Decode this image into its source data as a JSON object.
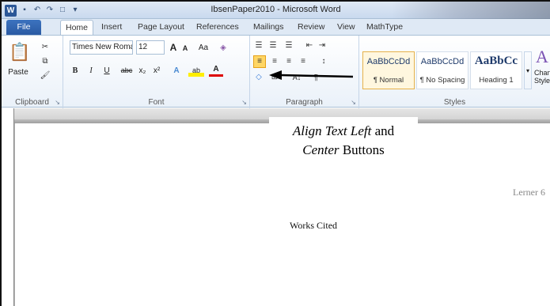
{
  "window": {
    "title": "IbsenPaper2010 - Microsoft Word",
    "app_logo": "W"
  },
  "tabs": [
    "File",
    "Home",
    "Insert",
    "Page Layout",
    "References",
    "Mailings",
    "Review",
    "View",
    "MathType"
  ],
  "clipboard": {
    "paste_label": "Paste",
    "group_label": "Clipboard"
  },
  "font": {
    "name": "Times New Roma",
    "size": "12",
    "group_label": "Font",
    "grow": "A",
    "shrink": "A",
    "case": "Aa",
    "bold": "B",
    "italic": "I",
    "underline": "U",
    "strike": "abc",
    "sub": "x₂",
    "sup": "x²",
    "highlight": "ab",
    "color": "A"
  },
  "paragraph": {
    "group_label": "Paragraph",
    "sort": "A↓",
    "pilcrow": "¶"
  },
  "styles": {
    "group_label": "Styles",
    "items": [
      {
        "sample": "AaBbCcDd",
        "name": "¶ Normal"
      },
      {
        "sample": "AaBbCcDd",
        "name": "¶ No Spacing"
      },
      {
        "sample": "AaBbCc",
        "name": "Heading 1"
      }
    ],
    "change_styles": "Change Styles",
    "change_sample": "A"
  },
  "callout": {
    "line1_italic": "Align Text Left",
    "line1_rest": " and",
    "line2_italic": "Center",
    "line2_rest": " Buttons"
  },
  "document": {
    "header": "Lerner 6",
    "heading": "Works Cited"
  }
}
